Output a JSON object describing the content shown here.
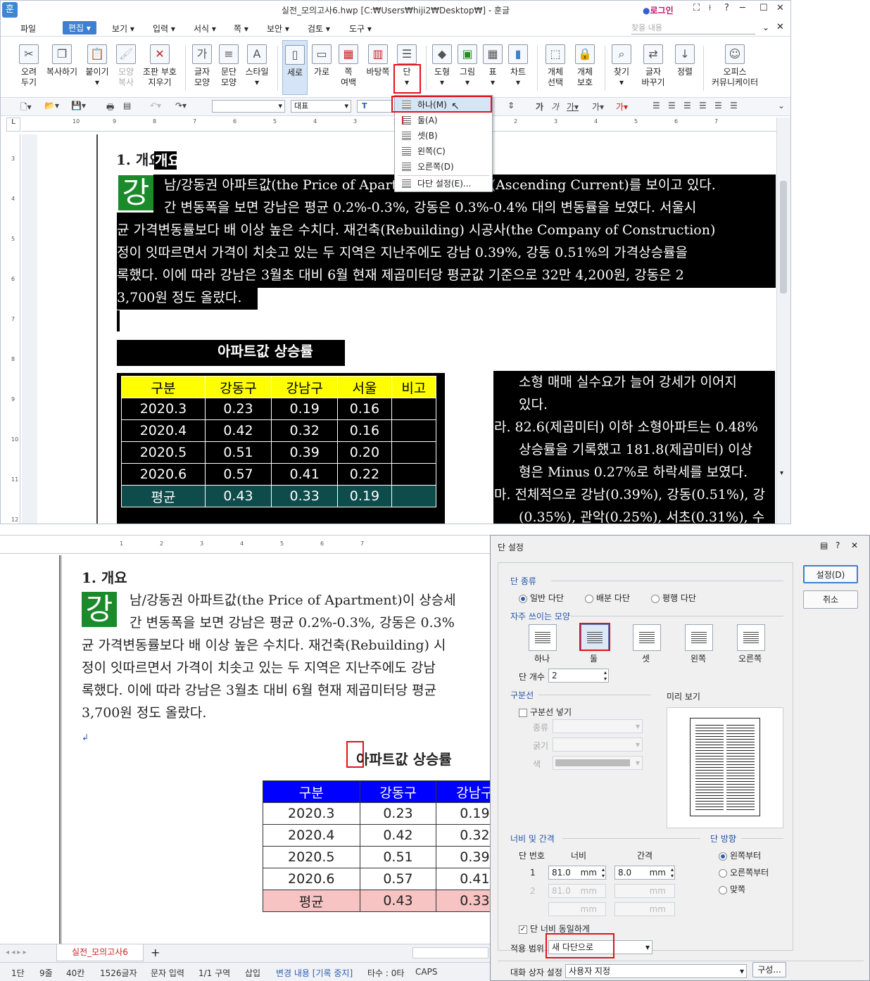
{
  "window": {
    "title": "실전_모의고사6.hwp [C:₩Users₩hiji2₩Desktop₩] - 훈글",
    "app_icon": "훈",
    "login": "로그인",
    "controls": [
      "⛶",
      "⟊",
      "?",
      "─",
      "☐",
      "✕"
    ],
    "search_placeholder": "찾을 내용"
  },
  "menu": [
    "파일",
    "편집",
    "보기",
    "입력",
    "서식",
    "쪽",
    "보안",
    "검토",
    "도구"
  ],
  "ribbon": {
    "cut": "오려\n두기",
    "copy": "복사하기",
    "paste": "붙이기",
    "format_copy": "모양\n복사",
    "clear_marks": "조판 부호\n지우기",
    "char_shape": "글자\n모양",
    "para_shape": "문단\n모양",
    "style": "스타일",
    "portrait": "세로",
    "landscape": "가로",
    "margin": "쪽\n여백",
    "background": "바탕쪽",
    "columns": "단",
    "shape": "도형",
    "picture": "그림",
    "table": "표",
    "chart": "차트",
    "obj_select": "개체\n선택",
    "obj_protect": "개체\n보호",
    "find": "찾기",
    "replace": "글자\n바꾸기",
    "sort": "정렬",
    "office": "오피스\n커뮤니케이터"
  },
  "toolbar2": {
    "style_box": "",
    "font_box": "대표",
    "font_type": "T"
  },
  "columns_menu": {
    "items": [
      "하나(M)",
      "둘(A)",
      "셋(B)",
      "왼쪽(C)",
      "오른쪽(D)",
      "다단 설정(E)..."
    ]
  },
  "ruler_top": [
    "10",
    "9",
    "8",
    "7",
    "6",
    "5",
    "4",
    "3",
    "2",
    "1",
    "1",
    "2",
    "3",
    "4",
    "5",
    "6",
    "7"
  ],
  "ruler_left": [
    "3",
    "4",
    "5",
    "6",
    "7",
    "8",
    "9",
    "10",
    "11",
    "12"
  ],
  "doc": {
    "heading": "1. 개요",
    "dropcap": "강",
    "para_lines_top": [
      "남/강동권 아파트값(the Price of Apartment)이 상승세(Ascending Current)를 보이고 있다.",
      "간 변동폭을 보면 강남은 평균 0.2%-0.3%, 강동은 0.3%-0.4% 대의 변동률을 보였다. 서울시",
      "균 가격변동률보다 배 이상 높은 수치다. 재건축(Rebuilding) 시공사(the Company of Construction)",
      "정이 잇따르면서 가격이 치솟고 있는 두 지역은 지난주에도 강남 0.39%, 강동 0.51%의 가격상승률을",
      "록했다. 이에 따라 강남은 3월초 대비 6월 현재 제곱미터당 평균값 기준으로 32만 4,200원, 강동은 2",
      "3,700원 정도 올랐다."
    ],
    "para_lines_bottom": [
      "남/강동권 아파트값(the Price of Apartment)이 상승세",
      "간 변동폭을 보면 강남은 평균 0.2%-0.3%, 강동은 0.3%",
      "균 가격변동률보다 배 이상 높은 수치다. 재건축(Rebuilding) 시",
      "정이 잇따르면서 가격이 치솟고 있는 두 지역은 지난주에도 강남",
      "록했다. 이에 따라 강남은 3월초 대비 6월 현재 제곱미터당 평균",
      "3,700원 정도 올랐다."
    ],
    "table_title": "아파트값 상승률",
    "table_header": [
      "구분",
      "강동구",
      "강남구",
      "서울",
      "비고"
    ],
    "table_rows": [
      [
        "2020.3",
        "0.23",
        "0.19",
        "0.16",
        ""
      ],
      [
        "2020.4",
        "0.42",
        "0.32",
        "0.16",
        ""
      ],
      [
        "2020.5",
        "0.51",
        "0.39",
        "0.20",
        ""
      ],
      [
        "2020.6",
        "0.57",
        "0.41",
        "0.22",
        ""
      ]
    ],
    "table_avg": [
      "평균",
      "0.43",
      "0.33",
      "0.19",
      ""
    ],
    "table_bottom_col4": [
      "서",
      "0.1",
      "0.1",
      "0.2",
      "0.2",
      "0.1"
    ],
    "right_col_lines": [
      "소형 매매 실수요가 늘어 강세가 이어지",
      "있다.",
      "라. 82.6(제곱미터) 이하 소형아파트는 0.48%",
      "상승률을 기록했고 181.8(제곱미터) 이상",
      "형은 Minus 0.27%로 하락세를 보였다.",
      "마. 전체적으로 강남(0.39%), 강동(0.51%), 강",
      "(0.35%), 관악(0.25%), 서초(0.31%), 수"
    ]
  },
  "tabs": {
    "doc_tab": "실전_모의고사6",
    "add": "+"
  },
  "status": [
    "1단",
    "9줄",
    "40칸",
    "1526글자",
    "문자 입력",
    "1/1 구역",
    "삽입",
    "변경 내용 [기록 중지]",
    "타수 : 0타",
    "CAPS"
  ],
  "dialog": {
    "title": "단 설정",
    "ok": "설정(D)",
    "cancel": "취소",
    "sec_type": "단 종류",
    "types": [
      "일반 다단",
      "배분 다단",
      "평행 다단"
    ],
    "sec_common": "자주 쓰이는 모양",
    "shapes": [
      "하나",
      "둘",
      "셋",
      "왼쪽",
      "오른쪽"
    ],
    "count_label": "단 개수",
    "count_value": "2",
    "sec_divider": "구분선",
    "divider_check": "구분선 넣기",
    "divider_kind": "종류",
    "divider_width": "굵기",
    "divider_color": "색",
    "preview_label": "미리 보기",
    "sec_width": "너비 및 간격",
    "col_no": "단 번호",
    "col_width": "너비",
    "col_gap": "간격",
    "rows": [
      {
        "no": "1",
        "width": "81.0",
        "gap": "8.0"
      },
      {
        "no": "2",
        "width": "81.0",
        "gap": ""
      }
    ],
    "unit": "mm",
    "sec_dir": "단 방향",
    "dirs": [
      "왼쪽부터",
      "오른쪽부터",
      "맞쪽"
    ],
    "equal_width": "단 너비 동일하게",
    "apply_label": "적용 범위",
    "apply_value": "새 다단으로",
    "dlg_setting_label": "대화 상자 설정",
    "dlg_setting_value": "사용자 지정",
    "config_btn": "구성..."
  },
  "colors": {
    "accent": "#3d7fd0",
    "red_box": "#e0131a",
    "dropcap_green": "#1a8a2a",
    "header_yellow": "#ffff00",
    "header_blue": "#0000ff",
    "avg_teal": "#0e4b4b",
    "avg_pink": "#f7c3c3"
  }
}
